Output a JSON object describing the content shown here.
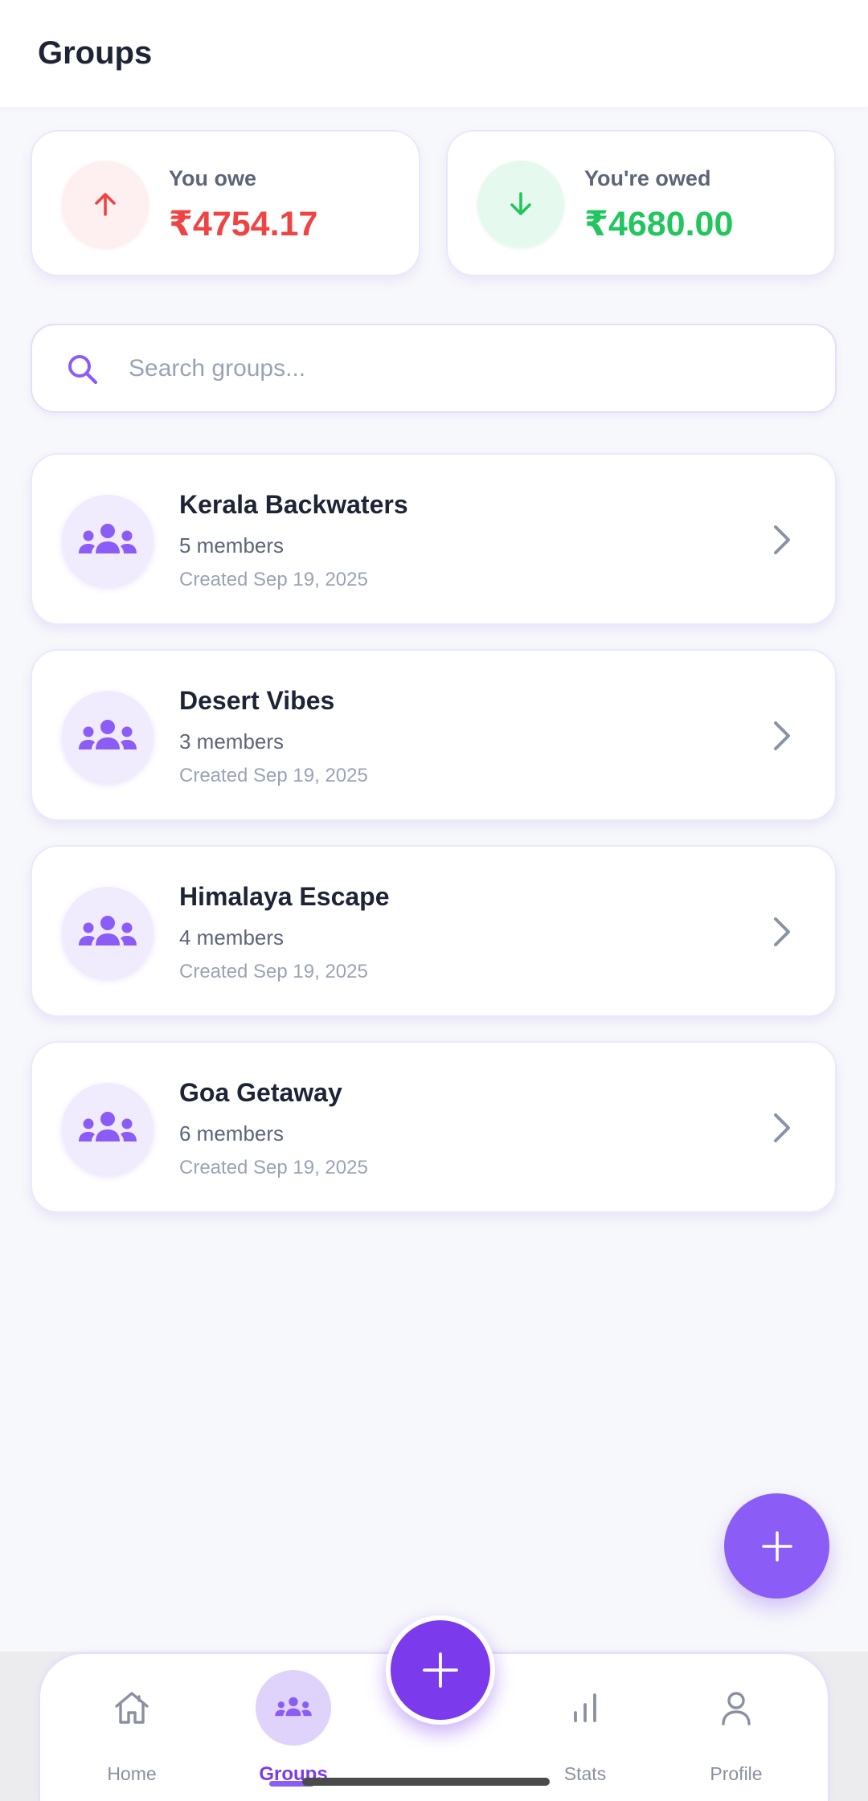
{
  "header": {
    "title": "Groups"
  },
  "summary": {
    "owe": {
      "label": "You owe",
      "amount": "₹4754.17",
      "icon": "arrow-up-icon",
      "color": "#ef4444"
    },
    "owed": {
      "label": "You're owed",
      "amount": "₹4680.00",
      "icon": "arrow-down-icon",
      "color": "#22c55e"
    }
  },
  "search": {
    "placeholder": "Search groups...",
    "value": "",
    "icon": "search-icon"
  },
  "groups": [
    {
      "name": "Kerala Backwaters",
      "members": "5 members",
      "created": "Created Sep 19, 2025"
    },
    {
      "name": "Desert Vibes",
      "members": "3 members",
      "created": "Created Sep 19, 2025"
    },
    {
      "name": "Himalaya Escape",
      "members": "4 members",
      "created": "Created Sep 19, 2025"
    },
    {
      "name": "Goa Getaway",
      "members": "6 members",
      "created": "Created Sep 19, 2025"
    }
  ],
  "nav": {
    "items": [
      {
        "label": "Home",
        "icon": "home-icon",
        "active": false
      },
      {
        "label": "Groups",
        "icon": "users-icon",
        "active": true
      },
      {
        "label": "Stats",
        "icon": "bar-chart-icon",
        "active": false
      },
      {
        "label": "Profile",
        "icon": "person-icon",
        "active": false
      }
    ]
  },
  "colors": {
    "accent": "#8b5cf6",
    "accent_dark": "#7c3aed",
    "background": "#f7f8fb"
  }
}
